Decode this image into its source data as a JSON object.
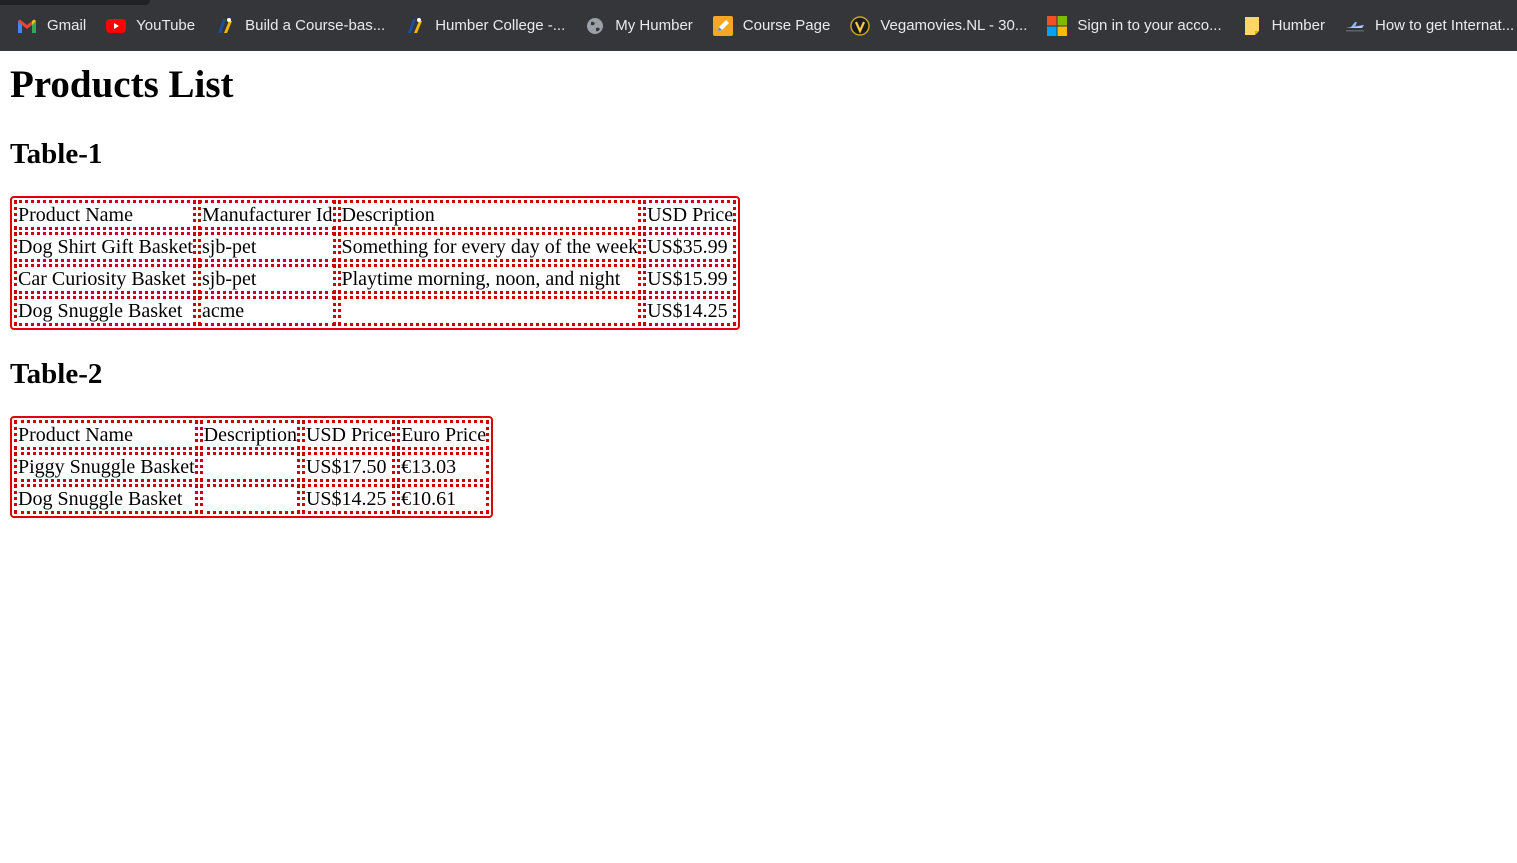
{
  "bookmarks": [
    {
      "label": "Gmail",
      "icon": "gmail-icon"
    },
    {
      "label": "YouTube",
      "icon": "youtube-icon"
    },
    {
      "label": "Build a Course-bas...",
      "icon": "humber-logo-icon"
    },
    {
      "label": "Humber College -...",
      "icon": "humber-logo-icon"
    },
    {
      "label": "My Humber",
      "icon": "globe-icon"
    },
    {
      "label": "Course Page",
      "icon": "pencil-icon"
    },
    {
      "label": "Vegamovies.NL - 30...",
      "icon": "vegamovies-icon"
    },
    {
      "label": "Sign in to your acco...",
      "icon": "microsoft-icon"
    },
    {
      "label": "Humber",
      "icon": "note-icon"
    },
    {
      "label": "How to get Internat...",
      "icon": "plane-icon"
    }
  ],
  "page": {
    "title": "Products List",
    "table1": {
      "heading": "Table-1",
      "headers": [
        "Product Name",
        "Manufacturer Id",
        "Description",
        "USD Price"
      ],
      "rows": [
        [
          "Dog Shirt Gift Basket",
          "sjb-pet",
          "Something for every day of the week",
          "US$35.99"
        ],
        [
          "Car Curiosity Basket",
          "sjb-pet",
          "Playtime morning, noon, and night",
          "US$15.99"
        ],
        [
          "Dog Snuggle Basket",
          "acme",
          "",
          "US$14.25"
        ]
      ]
    },
    "table2": {
      "heading": "Table-2",
      "headers": [
        "Product Name",
        "Description",
        "USD Price",
        "Euro Price"
      ],
      "rows": [
        [
          "Piggy Snuggle Basket",
          "",
          "US$17.50",
          "€13.03"
        ],
        [
          "Dog Snuggle Basket",
          "",
          "US$14.25",
          "€10.61"
        ]
      ]
    }
  },
  "colors": {
    "bookmarks_bar_bg": "#35363a",
    "bookmarks_text": "#e8eaed",
    "table_border": "#e00000",
    "cell_border": "#cc0000"
  }
}
